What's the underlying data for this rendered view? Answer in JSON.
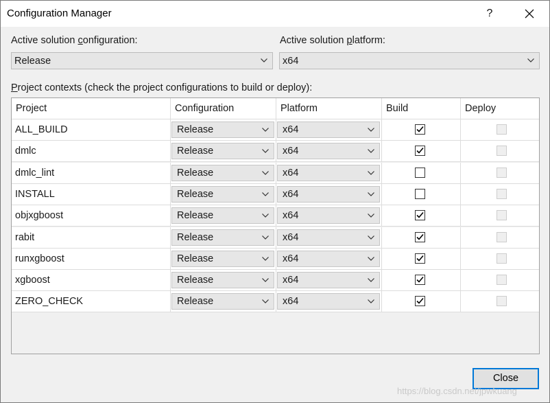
{
  "window": {
    "title": "Configuration Manager",
    "help": "?"
  },
  "solution_config": {
    "label_pre": "Active solution ",
    "label_key": "c",
    "label_post": "onfiguration:",
    "value": "Release"
  },
  "solution_platform": {
    "label_pre": "Active solution ",
    "label_key": "p",
    "label_post": "latform:",
    "value": "x64"
  },
  "contexts_label": {
    "key": "P",
    "rest": "roject contexts (check the project configurations to build or deploy):"
  },
  "grid": {
    "headers": [
      "Project",
      "Configuration",
      "Platform",
      "Build",
      "Deploy"
    ],
    "rows": [
      {
        "project": "ALL_BUILD",
        "configuration": "Release",
        "platform": "x64",
        "build": true,
        "deploy": false
      },
      {
        "project": "dmlc",
        "configuration": "Release",
        "platform": "x64",
        "build": true,
        "deploy": false
      },
      {
        "project": "dmlc_lint",
        "configuration": "Release",
        "platform": "x64",
        "build": false,
        "deploy": false
      },
      {
        "project": "INSTALL",
        "configuration": "Release",
        "platform": "x64",
        "build": false,
        "deploy": false
      },
      {
        "project": "objxgboost",
        "configuration": "Release",
        "platform": "x64",
        "build": true,
        "deploy": false
      },
      {
        "project": "rabit",
        "configuration": "Release",
        "platform": "x64",
        "build": true,
        "deploy": false
      },
      {
        "project": "runxgboost",
        "configuration": "Release",
        "platform": "x64",
        "build": true,
        "deploy": false
      },
      {
        "project": "xgboost",
        "configuration": "Release",
        "platform": "x64",
        "build": true,
        "deploy": false
      },
      {
        "project": "ZERO_CHECK",
        "configuration": "Release",
        "platform": "x64",
        "build": true,
        "deploy": false
      }
    ]
  },
  "buttons": {
    "close": "Close"
  },
  "watermark": "https://blog.csdn.net/jpwkuang",
  "colors": {
    "focus_border": "#0078d7",
    "combo_bg": "#e6e6e6",
    "dialog_bg": "#f0f0f0"
  }
}
